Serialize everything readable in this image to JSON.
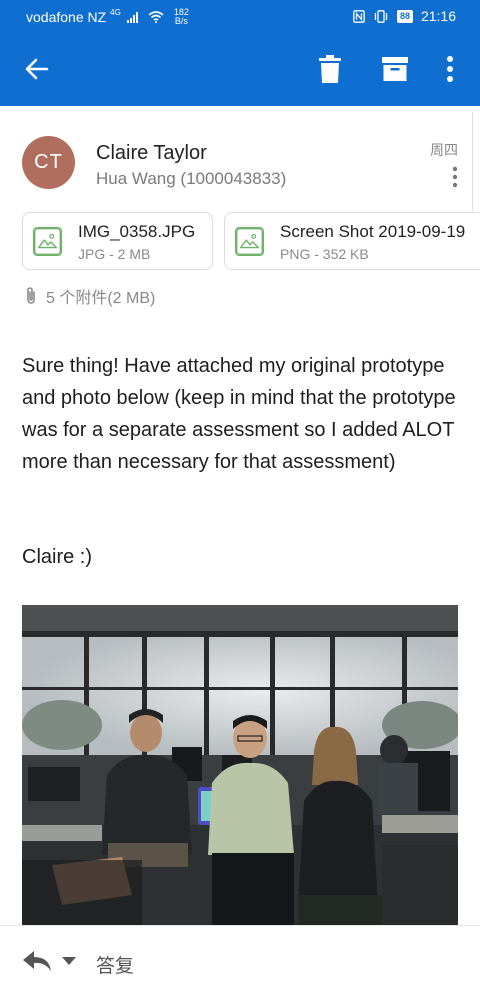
{
  "status_bar": {
    "carrier": "vodafone NZ",
    "network": "4G",
    "net_speed_value": "182",
    "net_speed_unit": "B/s",
    "battery": "88",
    "time": "21:16"
  },
  "app_bar": {
    "icons": [
      "back-icon",
      "trash-icon",
      "archive-icon",
      "more-icon"
    ],
    "color": "#0f6fd0"
  },
  "message": {
    "avatar_initials": "CT",
    "avatar_color": "#b06e5e",
    "sender": "Claire Taylor",
    "recipient": "Hua Wang (1000043833)",
    "date": "周四",
    "attachments": [
      {
        "name": "IMG_0358.JPG",
        "meta": "JPG - 2 MB",
        "icon": "image-icon"
      },
      {
        "name": "Screen Shot 2019-09-19",
        "meta": "PNG - 352 KB",
        "icon": "image-icon"
      }
    ],
    "attachment_summary": "5 个附件(2 MB)",
    "body": "Sure thing! Have attached my original prototype and photo below (keep in mind that the prototype was for a separate assessment so I added ALOT more than necessary for that assessment)",
    "signoff": "Claire :)"
  },
  "reply_bar": {
    "label": "答复"
  }
}
